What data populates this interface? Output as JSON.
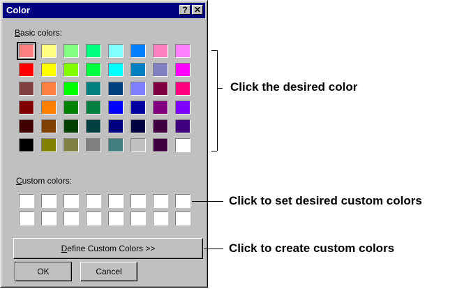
{
  "dialog": {
    "title": "Color",
    "help_label": "?",
    "close_label": "✕",
    "basic_label_accel": "B",
    "basic_label_rest": "asic colors:",
    "custom_label_accel": "C",
    "custom_label_rest": "ustom colors:",
    "define_accel": "D",
    "define_rest": "efine Custom Colors >>",
    "ok_label": "OK",
    "cancel_label": "Cancel"
  },
  "basic_colors": [
    [
      "#ff8080",
      "#ffff80",
      "#80ff80",
      "#00ff80",
      "#80ffff",
      "#0080ff",
      "#ff80c0",
      "#ff80ff"
    ],
    [
      "#ff0000",
      "#ffff00",
      "#80ff00",
      "#00ff40",
      "#00ffff",
      "#0080c0",
      "#8080c0",
      "#ff00ff"
    ],
    [
      "#804040",
      "#ff8040",
      "#00ff00",
      "#008080",
      "#004080",
      "#8080ff",
      "#800040",
      "#ff0080"
    ],
    [
      "#800000",
      "#ff8000",
      "#008000",
      "#008040",
      "#0000ff",
      "#0000a0",
      "#800080",
      "#8000ff"
    ],
    [
      "#400000",
      "#804000",
      "#004000",
      "#004040",
      "#000080",
      "#000040",
      "#400040",
      "#400080"
    ],
    [
      "#000000",
      "#808000",
      "#808040",
      "#808080",
      "#408080",
      "#c0c0c0",
      "#400040",
      "#ffffff"
    ]
  ],
  "selected_basic": {
    "row": 0,
    "col": 0
  },
  "custom_colors_count": 16,
  "annotations": {
    "basic": "Click the desired color",
    "custom": "Click to set desired custom colors",
    "define": "Click to create custom colors"
  }
}
